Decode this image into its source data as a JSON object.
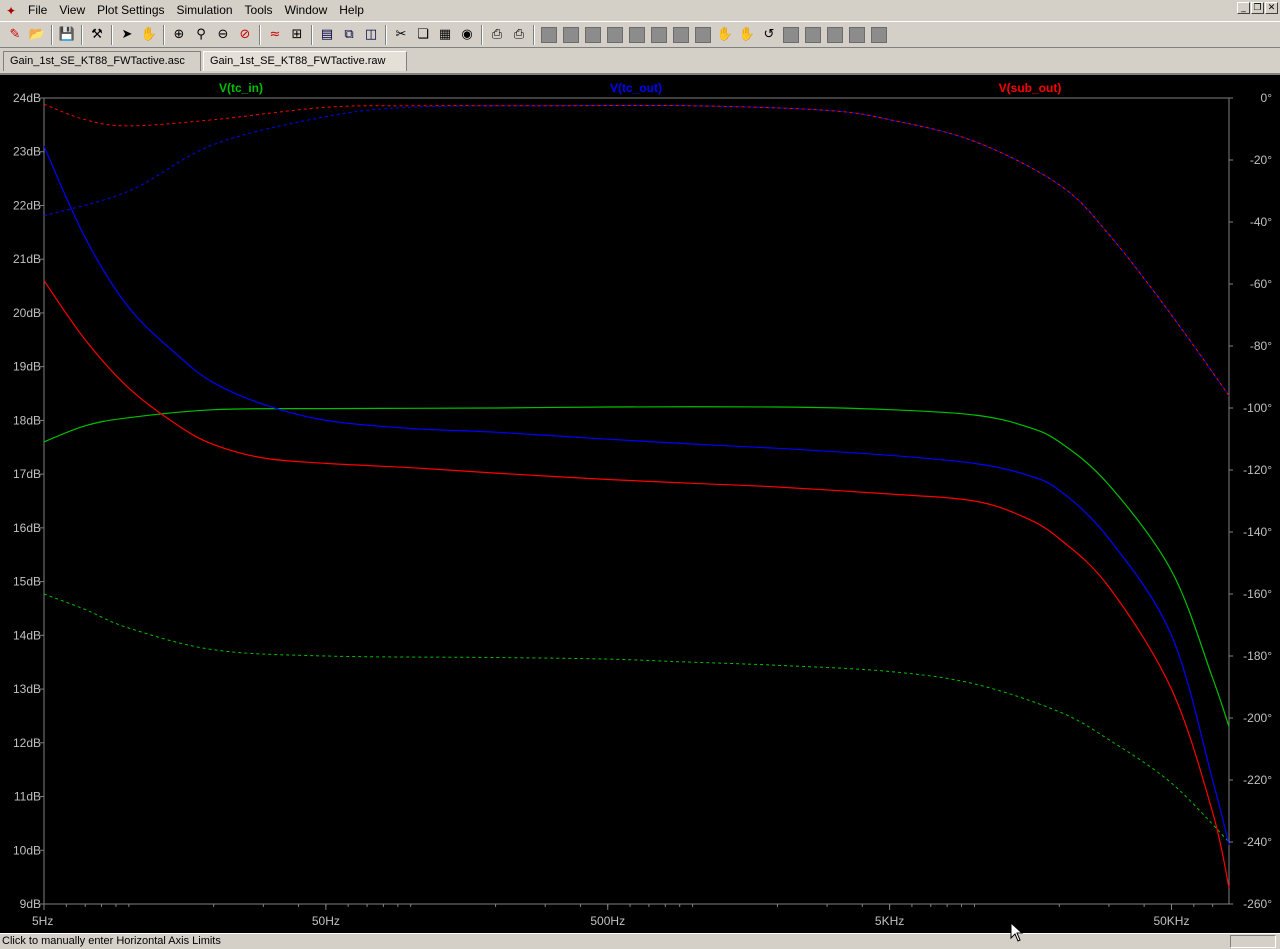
{
  "menu": {
    "items": [
      "File",
      "View",
      "Plot Settings",
      "Simulation",
      "Tools",
      "Window",
      "Help"
    ]
  },
  "toolbar": {
    "icons": [
      "new-schematic-icon",
      "open-icon",
      "save-icon",
      "control-panel-icon",
      "run-icon",
      "halt-icon",
      "zoom-in-icon",
      "zoom-area-icon",
      "zoom-out-icon",
      "zoom-cancel-icon",
      "autorange-icon",
      "add-trace-icon",
      "tile-horizontal-icon",
      "cascade-icon",
      "tile-vertical-icon",
      "cut-icon",
      "copy-icon",
      "paste-icon",
      "find-icon",
      "print-preview-icon",
      "print-icon"
    ]
  },
  "tabs": [
    {
      "label": "Gain_1st_SE_KT88_FWTactive.asc",
      "active": false
    },
    {
      "label": "Gain_1st_SE_KT88_FWTactive.raw",
      "active": true
    }
  ],
  "status": {
    "text": "Click to manually enter Horizontal Axis Limits"
  },
  "chart_data": {
    "type": "line",
    "x_scale": "log",
    "xlim": [
      5,
      80000
    ],
    "x_ticks": [
      {
        "label": "5Hz",
        "value": 5
      },
      {
        "label": "50Hz",
        "value": 50
      },
      {
        "label": "500Hz",
        "value": 500
      },
      {
        "label": "5KHz",
        "value": 5000
      },
      {
        "label": "50KHz",
        "value": 50000
      }
    ],
    "ylim": [
      9,
      24
    ],
    "y_ticks": [
      "9dB",
      "10dB",
      "11dB",
      "12dB",
      "13dB",
      "14dB",
      "15dB",
      "16dB",
      "17dB",
      "18dB",
      "19dB",
      "20dB",
      "21dB",
      "22dB",
      "23dB",
      "24dB"
    ],
    "y2lim": [
      -260,
      0
    ],
    "y2_ticks": [
      "-260°",
      "-240°",
      "-220°",
      "-200°",
      "-180°",
      "-160°",
      "-140°",
      "-120°",
      "-100°",
      "-80°",
      "-60°",
      "-40°",
      "-20°",
      "0°"
    ],
    "colors": {
      "background": "#000000",
      "grid": "#808080",
      "axis_text": "#c0c0c0"
    },
    "series": [
      {
        "name": "V(tc_in)",
        "color": "#00c000",
        "magnitude_db": [
          [
            5,
            17.6
          ],
          [
            7,
            17.9
          ],
          [
            10,
            18.05
          ],
          [
            20,
            18.2
          ],
          [
            50,
            18.22
          ],
          [
            200,
            18.23
          ],
          [
            500,
            18.25
          ],
          [
            2000,
            18.25
          ],
          [
            5000,
            18.2
          ],
          [
            10000,
            18.1
          ],
          [
            15000,
            17.9
          ],
          [
            20000,
            17.6
          ],
          [
            30000,
            16.8
          ],
          [
            50000,
            15.2
          ],
          [
            70000,
            13.2
          ],
          [
            80000,
            12.3
          ]
        ],
        "phase_deg": [
          [
            5,
            -160
          ],
          [
            7,
            -165
          ],
          [
            10,
            -171
          ],
          [
            20,
            -178
          ],
          [
            50,
            -180
          ],
          [
            200,
            -180.5
          ],
          [
            500,
            -181
          ],
          [
            1000,
            -182
          ],
          [
            2000,
            -183
          ],
          [
            5000,
            -185
          ],
          [
            10000,
            -189
          ],
          [
            20000,
            -198
          ],
          [
            30000,
            -207
          ],
          [
            50000,
            -221
          ],
          [
            80000,
            -240
          ]
        ]
      },
      {
        "name": "V(tc_out)",
        "color": "#0000ff",
        "magnitude_db": [
          [
            5,
            23.1
          ],
          [
            7,
            21.4
          ],
          [
            10,
            20.1
          ],
          [
            15,
            19.2
          ],
          [
            20,
            18.7
          ],
          [
            30,
            18.3
          ],
          [
            50,
            18.0
          ],
          [
            100,
            17.85
          ],
          [
            200,
            17.78
          ],
          [
            500,
            17.65
          ],
          [
            1000,
            17.56
          ],
          [
            2000,
            17.48
          ],
          [
            5000,
            17.35
          ],
          [
            10000,
            17.2
          ],
          [
            15000,
            17.0
          ],
          [
            20000,
            16.7
          ],
          [
            30000,
            15.8
          ],
          [
            50000,
            14.0
          ],
          [
            70000,
            11.3
          ],
          [
            80000,
            10.1
          ]
        ],
        "phase_deg": [
          [
            5,
            -38
          ],
          [
            10,
            -30
          ],
          [
            20,
            -15
          ],
          [
            50,
            -6
          ],
          [
            100,
            -3
          ],
          [
            300,
            -2.5
          ],
          [
            1000,
            -2.5
          ],
          [
            3000,
            -4
          ],
          [
            5000,
            -7
          ],
          [
            10000,
            -14
          ],
          [
            20000,
            -28
          ],
          [
            30000,
            -44
          ],
          [
            50000,
            -70
          ],
          [
            80000,
            -96
          ]
        ]
      },
      {
        "name": "V(sub_out)",
        "color": "#ff0000",
        "magnitude_db": [
          [
            5,
            20.6
          ],
          [
            7,
            19.5
          ],
          [
            10,
            18.6
          ],
          [
            15,
            17.9
          ],
          [
            20,
            17.55
          ],
          [
            30,
            17.3
          ],
          [
            50,
            17.2
          ],
          [
            100,
            17.12
          ],
          [
            200,
            17.02
          ],
          [
            500,
            16.9
          ],
          [
            1000,
            16.83
          ],
          [
            2000,
            16.76
          ],
          [
            5000,
            16.63
          ],
          [
            10000,
            16.5
          ],
          [
            15000,
            16.2
          ],
          [
            20000,
            15.8
          ],
          [
            30000,
            14.9
          ],
          [
            50000,
            13.0
          ],
          [
            70000,
            10.7
          ],
          [
            80000,
            9.3
          ]
        ],
        "phase_deg": [
          [
            5,
            -2
          ],
          [
            7,
            -7
          ],
          [
            10,
            -9
          ],
          [
            20,
            -7
          ],
          [
            50,
            -3
          ],
          [
            100,
            -2.5
          ],
          [
            300,
            -2.5
          ],
          [
            1000,
            -2.5
          ],
          [
            3000,
            -4
          ],
          [
            5000,
            -7
          ],
          [
            10000,
            -14
          ],
          [
            20000,
            -28
          ],
          [
            30000,
            -44
          ],
          [
            50000,
            -70
          ],
          [
            80000,
            -96
          ]
        ]
      }
    ]
  }
}
